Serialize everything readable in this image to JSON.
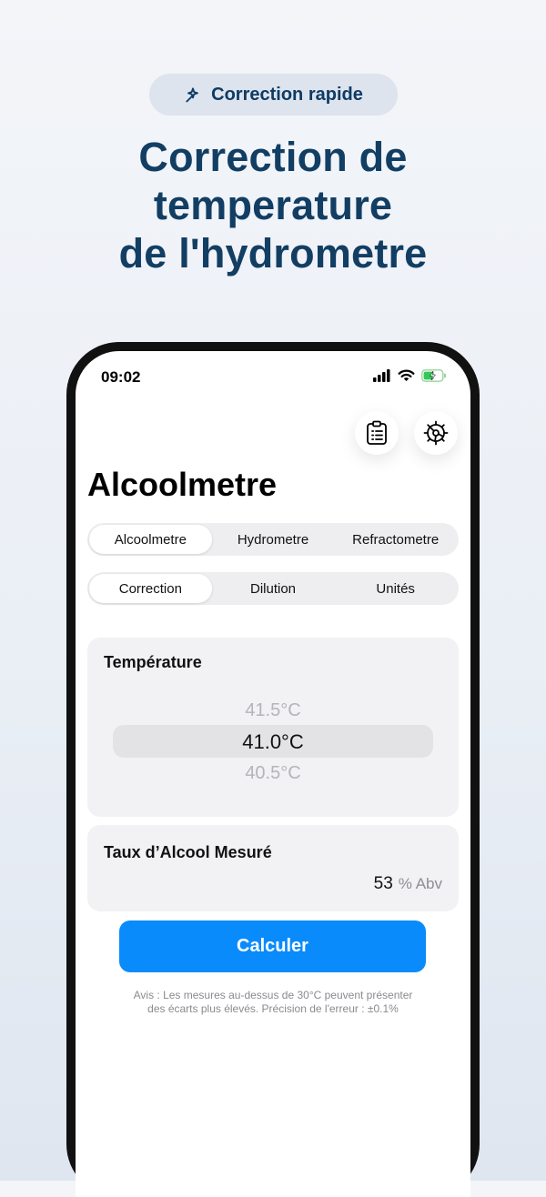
{
  "promo": {
    "badge_icon": "magic-wand-icon",
    "badge_label": "Correction rapide",
    "headline_lines": [
      "Correction de",
      "temperature",
      "de l'hydrometre"
    ]
  },
  "status_bar": {
    "time": "09:02",
    "icons": [
      "signal-icon",
      "wifi-icon",
      "battery-charging-icon"
    ]
  },
  "toolbar": {
    "history_icon": "clipboard-list-icon",
    "settings_icon": "gear-icon"
  },
  "app": {
    "title": "Alcoolmetre",
    "instrument_tabs": [
      "Alcoolmetre",
      "Hydrometre",
      "Refractometre"
    ],
    "mode_tabs": [
      "Correction",
      "Dilution",
      "Unités"
    ]
  },
  "temperature": {
    "title": "Température",
    "options": [
      "41.5°C",
      "41.0°C",
      "40.5°C"
    ],
    "selected": "41.0°C"
  },
  "alcohol": {
    "title": "Taux d’Alcool Mesuré",
    "value": "53",
    "unit": "% Abv"
  },
  "calculate_label": "Calculer",
  "notice_lines": [
    "Avis : Les mesures au-dessus de 30°C peuvent présenter",
    "des écarts plus élevés. Précision de l'erreur : ±0.1%"
  ],
  "colors": {
    "accent": "#0a8bfb",
    "headline": "#123e63",
    "badge_bg": "#dde4ee"
  }
}
